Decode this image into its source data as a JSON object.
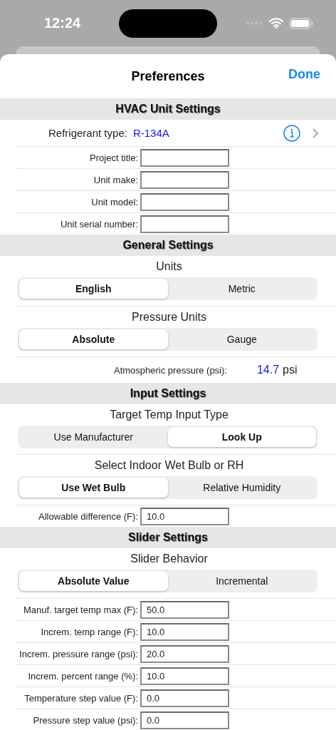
{
  "status_bar": {
    "time": "12:24"
  },
  "nav": {
    "title": "Preferences",
    "done": "Done"
  },
  "sections": [
    {
      "title": "HVAC Unit Settings",
      "rows": [
        {
          "kind": "link",
          "label": "Refrigerant type:",
          "value": "R-134A"
        },
        {
          "kind": "field",
          "label": "Project title:"
        },
        {
          "kind": "field",
          "label": "Unit make:"
        },
        {
          "kind": "field",
          "label": "Unit model:"
        },
        {
          "kind": "field",
          "label": "Unit serial number:"
        }
      ]
    },
    {
      "title": "General Settings",
      "rows": [
        {
          "kind": "segment",
          "title": "Units",
          "options": [
            {
              "label": "English",
              "selected": true
            },
            {
              "label": "Metric",
              "selected": false
            }
          ]
        },
        {
          "kind": "segment",
          "title": "Pressure Units",
          "options": [
            {
              "label": "Absolute",
              "selected": true
            },
            {
              "label": "Gauge",
              "selected": false
            }
          ]
        },
        {
          "kind": "reading",
          "label": "Atmospheric pressure (psi):",
          "value": "14.7",
          "unit": "psi"
        }
      ]
    },
    {
      "title": "Input Settings",
      "rows": [
        {
          "kind": "segment",
          "title": "Target Temp Input Type",
          "options": [
            {
              "label": "Use Manufacturer",
              "selected": false
            },
            {
              "label": "Look Up",
              "selected": true
            }
          ]
        },
        {
          "kind": "segment",
          "title": "Select Indoor Wet Bulb or RH",
          "options": [
            {
              "label": "Use Wet Bulb",
              "selected": true
            },
            {
              "label": "Relative Humidity",
              "selected": false
            }
          ]
        },
        {
          "kind": "field",
          "label": "Allowable difference (F):",
          "value": "10.0"
        }
      ]
    },
    {
      "title": "Slider Settings",
      "rows": [
        {
          "kind": "segment",
          "title": "Slider Behavior",
          "options": [
            {
              "label": "Absolute Value",
              "selected": true
            },
            {
              "label": "Incremental",
              "selected": false
            }
          ]
        },
        {
          "kind": "field",
          "label": "Manuf. target temp max (F):",
          "value": "50.0"
        },
        {
          "kind": "field",
          "label": "Increm. temp range (F):",
          "value": "10.0"
        },
        {
          "kind": "field",
          "label": "Increm. pressure range (psi):",
          "value": "20.0"
        },
        {
          "kind": "field",
          "label": "Increm. percent range (%):",
          "value": "10.0"
        },
        {
          "kind": "field",
          "label": "Temperature step value (F):",
          "value": "0.0"
        },
        {
          "kind": "field",
          "label": "Pressure step value (psi):",
          "value": "0.0"
        }
      ]
    }
  ]
}
